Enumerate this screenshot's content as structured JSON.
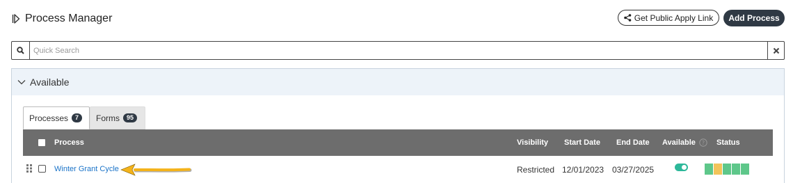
{
  "header": {
    "title": "Process Manager",
    "public_link_label": "Get Public Apply Link",
    "add_process_label": "Add Process"
  },
  "search": {
    "placeholder": "Quick Search"
  },
  "section": {
    "title": "Available"
  },
  "tabs": [
    {
      "label": "Processes",
      "count": "7"
    },
    {
      "label": "Forms",
      "count": "95"
    }
  ],
  "table": {
    "columns": [
      "Process",
      "Visibility",
      "Start Date",
      "End Date",
      "Available",
      "Status"
    ],
    "rows": [
      {
        "process": "Winter Grant Cycle",
        "visibility": "Restricted",
        "start_date": "12/01/2023",
        "end_date": "03/27/2025",
        "available": true,
        "status_segments": [
          "#5ec78a",
          "#f2c45a",
          "#5ec78a",
          "#5ec78a",
          "#5ec78a"
        ]
      }
    ]
  },
  "colors": {
    "accent": "#2f3944",
    "link": "#1a73c8",
    "toggle_on": "#2db89a",
    "arrow": "#f4b31b"
  }
}
